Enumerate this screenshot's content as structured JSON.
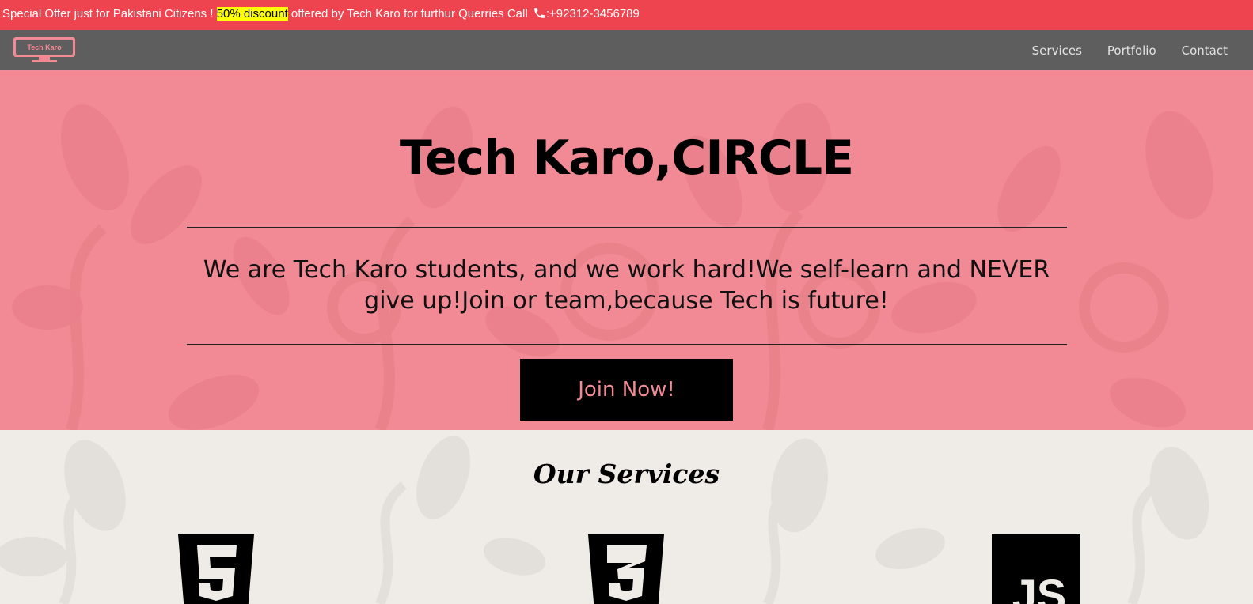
{
  "offer_bar": {
    "text_before": "Special Offer just for Pakistani Citizens ! ",
    "highlight": "50% discount",
    "text_after": " offered by Tech Karo for furthur Querries Call ",
    "phone": ":+92312-3456789",
    "icon": "phone-icon"
  },
  "navbar": {
    "logo_text": "Tech Karo",
    "links": [
      "Services",
      "Portfolio",
      "Contact"
    ]
  },
  "hero": {
    "title": "Tech Karo,CIRCLE",
    "text": "We are Tech Karo students, and we work hard!We self-learn and NEVER give up!Join or team,because Tech is future!",
    "button_label": "Join Now!"
  },
  "services": {
    "title": "Our Services",
    "icons": [
      "html5-icon",
      "css3-icon",
      "javascript-icon"
    ],
    "js_label": "JS"
  },
  "colors": {
    "offer_bar": "#ee444f",
    "highlight": "#ffff00",
    "navbar": "#5e5e5e",
    "hero": "#f28a95",
    "services_bg": "#efebe7",
    "button": "#000000"
  }
}
